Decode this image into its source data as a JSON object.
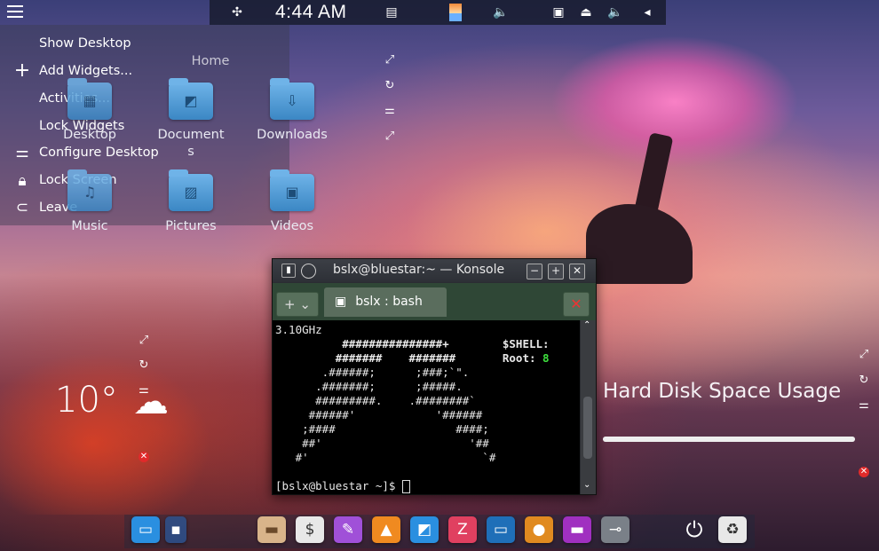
{
  "top_panel": {
    "clock": "4:44 AM"
  },
  "menu": {
    "items": [
      {
        "label": "Show Desktop",
        "icon": ""
      },
      {
        "label": "Add Widgets...",
        "icon": "plus-icon"
      },
      {
        "label": "Activities...",
        "icon": ""
      },
      {
        "label": "Lock Widgets",
        "icon": ""
      },
      {
        "label": "Configure Desktop",
        "icon": "sliders-icon"
      },
      {
        "label": "Lock Screen",
        "icon": "lock-icon"
      },
      {
        "label": "Leave",
        "icon": "leave-icon"
      }
    ]
  },
  "folders": [
    {
      "label": "Desktop"
    },
    {
      "label": "Home"
    },
    {
      "label": "Documents"
    },
    {
      "label": "Downloads"
    },
    {
      "label": "Music"
    },
    {
      "label": "Pictures"
    },
    {
      "label": "Videos"
    }
  ],
  "konsole": {
    "title": "bslx@bluestar:~ — Konsole",
    "tab_label": "bslx : bash",
    "lines": [
      "3.10GHz",
      "          ###############+        $SHELL:",
      "         #######    #######       Root: ",
      "       .######;      ;###;`\".",
      "      .#######;      ;#####.",
      "      #########.    .########`",
      "     ######'            '######",
      "    ;####                  ####;",
      "    ##'                      '##",
      "   #'                          `#",
      "",
      "[bslx@bluestar ~]$ "
    ],
    "root_value": "8"
  },
  "weather": {
    "temperature": "10°",
    "icon": "cloud-hail-icon"
  },
  "disk_widget": {
    "title": "Hard Disk Space Usage",
    "usage_fraction": 1.0
  },
  "colors": {
    "accent": "#3b87c4",
    "tab_green": "#2f4736",
    "close_red": "#e02a2a"
  }
}
